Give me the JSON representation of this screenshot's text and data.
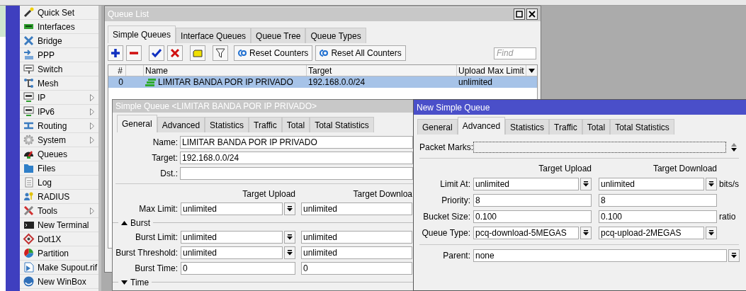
{
  "sidebar": {
    "items": [
      {
        "label": "Quick Set",
        "submenu": false
      },
      {
        "label": "Interfaces",
        "submenu": false
      },
      {
        "label": "Bridge",
        "submenu": false
      },
      {
        "label": "PPP",
        "submenu": false
      },
      {
        "label": "Switch",
        "submenu": false
      },
      {
        "label": "Mesh",
        "submenu": false
      },
      {
        "label": "IP",
        "submenu": true
      },
      {
        "label": "IPv6",
        "submenu": true
      },
      {
        "label": "Routing",
        "submenu": true
      },
      {
        "label": "System",
        "submenu": true
      },
      {
        "label": "Queues",
        "submenu": false
      },
      {
        "label": "Files",
        "submenu": false
      },
      {
        "label": "Log",
        "submenu": false
      },
      {
        "label": "RADIUS",
        "submenu": false
      },
      {
        "label": "Tools",
        "submenu": true
      },
      {
        "label": "New Terminal",
        "submenu": false
      },
      {
        "label": "Dot1X",
        "submenu": false
      },
      {
        "label": "Partition",
        "submenu": false
      },
      {
        "label": "Make Supout.rif",
        "submenu": false
      },
      {
        "label": "New WinBox",
        "submenu": false
      }
    ]
  },
  "queue_list": {
    "title": "Queue List",
    "active": false,
    "tabs": [
      {
        "label": "Simple Queues",
        "selected": true
      },
      {
        "label": "Interface Queues",
        "selected": false
      },
      {
        "label": "Queue Tree",
        "selected": false
      },
      {
        "label": "Queue Types",
        "selected": false
      }
    ],
    "toolbar": {
      "buttons": [
        {
          "label": "Reset Counters"
        },
        {
          "label": "Reset All Counters"
        }
      ],
      "find": {
        "placeholder": "Find"
      }
    },
    "table": {
      "columns": [
        "#",
        "Name",
        "Target",
        "Upload Max Limit"
      ],
      "rows": [
        {
          "number": "0",
          "name": "LIMITAR BANDA POR IP PRIVADO",
          "target": "192.168.0.0/24",
          "upload_max_limit": "unlimited",
          "selected": true
        }
      ]
    }
  },
  "simple_queue": {
    "title": "Simple Queue <LIMITAR BANDA POR IP PRIVADO>",
    "active": false,
    "tabs": [
      {
        "label": "General",
        "selected": true
      },
      {
        "label": "Advanced",
        "selected": false
      },
      {
        "label": "Statistics",
        "selected": false
      },
      {
        "label": "Traffic",
        "selected": false
      },
      {
        "label": "Total",
        "selected": false
      },
      {
        "label": "Total Statistics",
        "selected": false
      }
    ],
    "fields": [
      {
        "label": "Name:",
        "value": "LIMITAR BANDA POR IP PRIVADO"
      },
      {
        "label": "Target:",
        "value": "192.168.0.0/24"
      },
      {
        "label": "Dst.:"
      }
    ],
    "column_headers": [
      "Target Upload",
      "Target Downloa"
    ],
    "rows": [
      {
        "kind": "pair",
        "label": "Max Limit:",
        "upload": "unlimited",
        "download": "unlimited"
      },
      {
        "kind": "section",
        "label": "Burst",
        "expanded": true
      },
      {
        "kind": "pair",
        "label": "Burst Limit:",
        "upload": "unlimited",
        "download": "unlimited"
      },
      {
        "kind": "pair",
        "label": "Burst Threshold:",
        "upload": "unlimited",
        "download": "unlimited"
      },
      {
        "kind": "plain_pair",
        "label": "Burst Time:",
        "upload": "0",
        "download": "0"
      },
      {
        "kind": "section",
        "label": "Time",
        "expanded": false
      }
    ]
  },
  "new_simple_queue": {
    "title": "New Simple Queue",
    "active": true,
    "tabs": [
      {
        "label": "General",
        "selected": false
      },
      {
        "label": "Advanced",
        "selected": true
      },
      {
        "label": "Statistics",
        "selected": false
      },
      {
        "label": "Traffic",
        "selected": false
      },
      {
        "label": "Total",
        "selected": false
      },
      {
        "label": "Total Statistics",
        "selected": false
      }
    ],
    "packet_marks": {
      "label": "Packet Marks:"
    },
    "column_headers": [
      "Target Upload",
      "Target Download"
    ],
    "rows": [
      {
        "kind": "pair",
        "label": "Limit At:",
        "upload": "unlimited",
        "download": "unlimited",
        "unit": "bits/s"
      },
      {
        "kind": "plain_pair",
        "label": "Priority:",
        "upload": "8",
        "download": "8"
      },
      {
        "kind": "plain_pair",
        "label": "Bucket Size:",
        "upload": "0.100",
        "download": "0.100",
        "unit": "ratio"
      },
      {
        "kind": "pair",
        "label": "Queue Type:",
        "upload": "pcq-download-5MEGAS",
        "download": "pcq-upload-2MEGAS"
      }
    ],
    "parent": {
      "label": "Parent:",
      "value": "none"
    }
  }
}
